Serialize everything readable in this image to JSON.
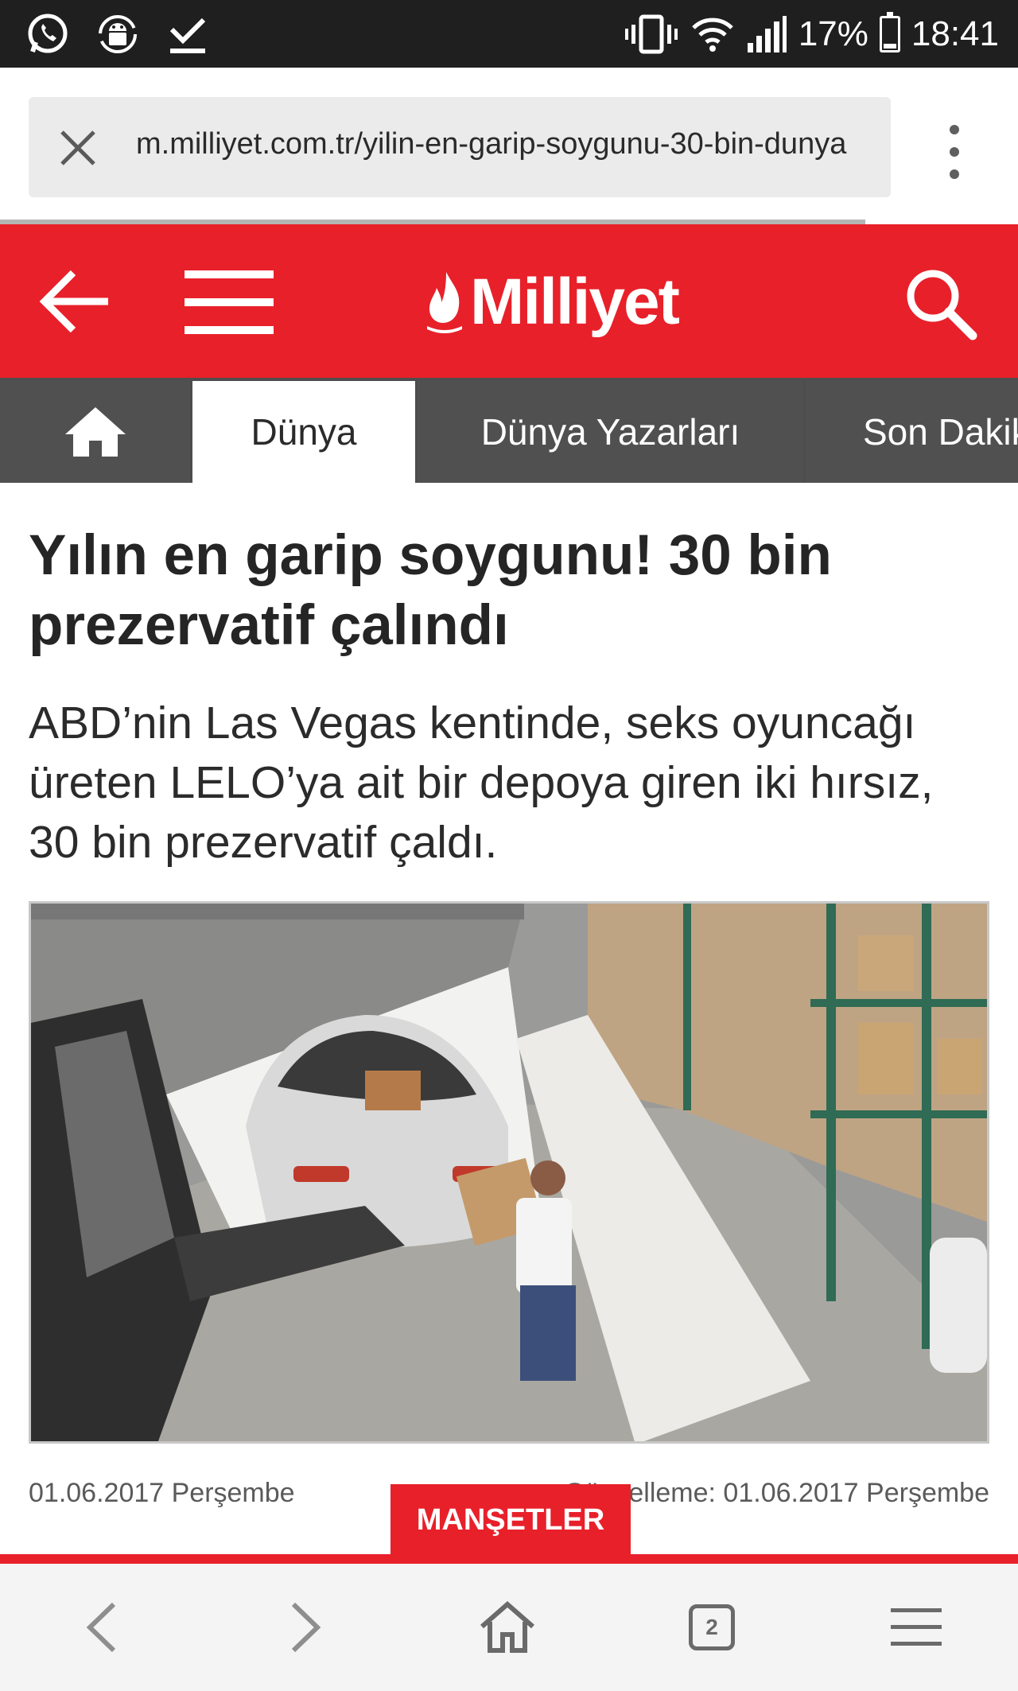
{
  "status_bar": {
    "battery": "17%",
    "time": "18:41",
    "icons": [
      "whatsapp-icon",
      "android-debug-icon",
      "download-done-icon",
      "vibrate-icon",
      "wifi-icon",
      "signal-icon",
      "battery-icon"
    ]
  },
  "browser": {
    "url": "m.milliyet.com.tr/yilin-en-garip-soygunu-30-bin-dunya",
    "tab_count": "2"
  },
  "site": {
    "logo_text": "Milliyet",
    "brand_color": "#e8202a"
  },
  "tabs": [
    {
      "label": "Dünya",
      "active": true
    },
    {
      "label": "Dünya Yazarları",
      "active": false
    },
    {
      "label": "Son Dakika",
      "active": false
    }
  ],
  "article": {
    "headline": "Yılın en garip soygunu! 30 bin prezervatif çalındı",
    "lede": "ABD’nin Las Vegas kentinde, seks oyuncağı üreten LELO’ya ait bir depoya giren iki hırsız, 30 bin prezervatif çaldı.",
    "date_published": "01.06.2017 Perşembe",
    "date_updated": "Güncelleme: 01.06.2017 Perşembe"
  },
  "manset_button": "MANŞETLER"
}
